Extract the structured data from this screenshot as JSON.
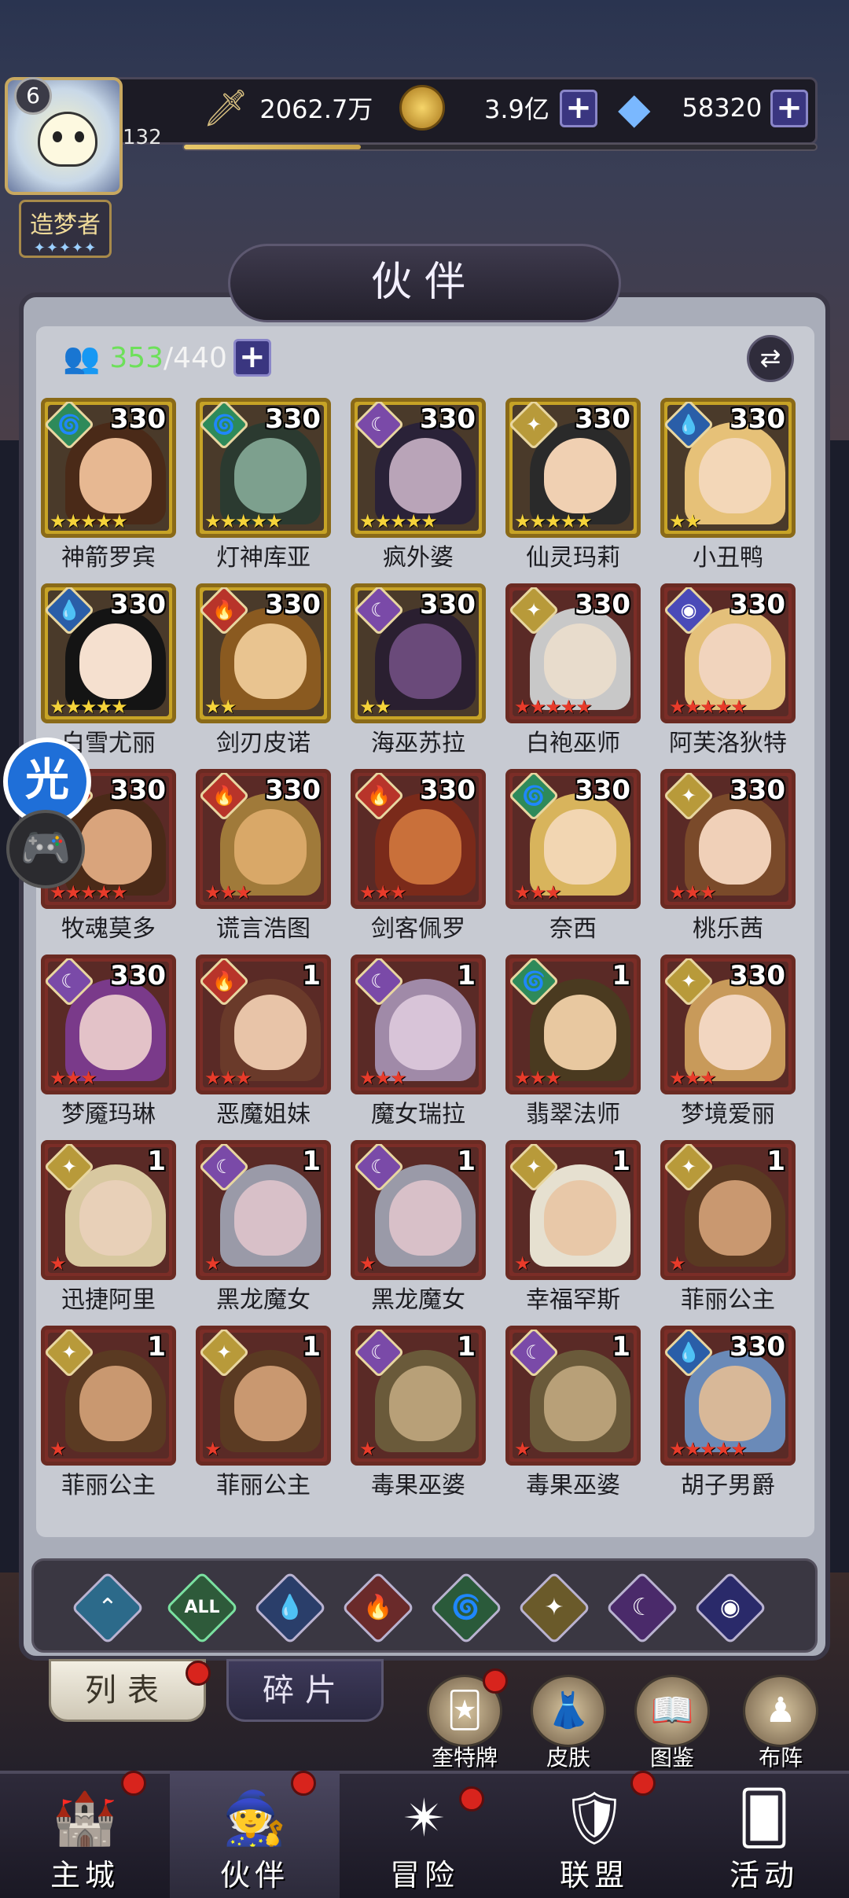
{
  "header": {
    "level_badge": "6",
    "player_level": "132",
    "title": "造梦者",
    "title_stars": "✦✦✦✦✦",
    "power": "2062.7万",
    "gold": "3.9亿",
    "gems": "58320",
    "exp_progress": 0.28
  },
  "panel": {
    "title": "伙伴",
    "owned": "353",
    "capacity": "/440"
  },
  "cards": [
    {
      "name": "神箭罗宾",
      "num": "330",
      "stars": "★★★★★",
      "starColor": "y",
      "elem": "wind",
      "frame": "gold",
      "skin": "#e7b892",
      "hair": "#4a2a18"
    },
    {
      "name": "灯神库亚",
      "num": "330",
      "stars": "★★★★★",
      "starColor": "y",
      "elem": "wind",
      "frame": "gold",
      "skin": "#7da08e",
      "hair": "#2b3a30"
    },
    {
      "name": "疯外婆",
      "num": "330",
      "stars": "★★★★★",
      "starColor": "y",
      "elem": "moon",
      "frame": "gold",
      "skin": "#b9a4b8",
      "hair": "#2a2238"
    },
    {
      "name": "仙灵玛莉",
      "num": "330",
      "stars": "★★★★★",
      "starColor": "y",
      "elem": "light",
      "frame": "gold",
      "skin": "#f0d0b2",
      "hair": "#2a2a2a"
    },
    {
      "name": "小丑鸭",
      "num": "330",
      "stars": "★★",
      "starColor": "y",
      "elem": "water",
      "frame": "gold",
      "skin": "#f3d7b8",
      "hair": "#e6c178"
    },
    {
      "name": "白雪尤丽",
      "num": "330",
      "stars": "★★★★★",
      "starColor": "y",
      "elem": "water",
      "frame": "gold",
      "skin": "#f5e0cf",
      "hair": "#141414"
    },
    {
      "name": "剑刃皮诺",
      "num": "330",
      "stars": "★★",
      "starColor": "y",
      "elem": "fire",
      "frame": "gold",
      "skin": "#e9c490",
      "hair": "#8a5a20"
    },
    {
      "name": "海巫苏拉",
      "num": "330",
      "stars": "★★",
      "starColor": "y",
      "elem": "moon",
      "frame": "gold",
      "skin": "#6a4a7a",
      "hair": "#2a1f30"
    },
    {
      "name": "白袍巫师",
      "num": "330",
      "stars": "★★★★★",
      "starColor": "r",
      "elem": "light",
      "frame": "red",
      "skin": "#e8dccc",
      "hair": "#c8c8c8"
    },
    {
      "name": "阿芙洛狄特",
      "num": "330",
      "stars": "★★★★★",
      "starColor": "r",
      "elem": "cosmos",
      "frame": "red",
      "skin": "#f1d4bd",
      "hair": "#e4c07a"
    },
    {
      "name": "牧魂莫多",
      "num": "330",
      "stars": "★★★★★",
      "starColor": "r",
      "elem": "fire",
      "frame": "red",
      "skin": "#d9a47c",
      "hair": "#4a2a18"
    },
    {
      "name": "谎言浩图",
      "num": "330",
      "stars": "★★★",
      "starColor": "r",
      "elem": "fire",
      "frame": "red",
      "skin": "#d9a868",
      "hair": "#a07a3a"
    },
    {
      "name": "剑客佩罗",
      "num": "330",
      "stars": "★★★",
      "starColor": "r",
      "elem": "fire",
      "frame": "red",
      "skin": "#c9703a",
      "hair": "#7a2a1a"
    },
    {
      "name": "奈西",
      "num": "330",
      "stars": "★★★",
      "starColor": "r",
      "elem": "wind",
      "frame": "red",
      "skin": "#f2d6b2",
      "hair": "#d8b45c"
    },
    {
      "name": "桃乐茜",
      "num": "330",
      "stars": "★★★",
      "starColor": "r",
      "elem": "light",
      "frame": "red",
      "skin": "#f0d0b8",
      "hair": "#7a4a2a"
    },
    {
      "name": "梦魇玛琳",
      "num": "330",
      "stars": "★★★",
      "starColor": "r",
      "elem": "moon",
      "frame": "red",
      "skin": "#e3c2c8",
      "hair": "#7a3a8a"
    },
    {
      "name": "恶魔姐妹",
      "num": "1",
      "stars": "★★★",
      "starColor": "r",
      "elem": "fire",
      "frame": "red",
      "skin": "#e8c4a8",
      "hair": "#6a3a2a"
    },
    {
      "name": "魔女瑞拉",
      "num": "1",
      "stars": "★★★",
      "starColor": "r",
      "elem": "moon",
      "frame": "red",
      "skin": "#d8c4d8",
      "hair": "#a08aa8"
    },
    {
      "name": "翡翠法师",
      "num": "1",
      "stars": "★★★",
      "starColor": "r",
      "elem": "wind",
      "frame": "red",
      "skin": "#e8c8a0",
      "hair": "#4a3a20"
    },
    {
      "name": "梦境爱丽",
      "num": "330",
      "stars": "★★★",
      "starColor": "r",
      "elem": "light",
      "frame": "red",
      "skin": "#f2d6c0",
      "hair": "#c89a5a"
    },
    {
      "name": "迅捷阿里",
      "num": "1",
      "stars": "★",
      "starColor": "r",
      "elem": "light",
      "frame": "red",
      "skin": "#e8d0b8",
      "hair": "#d8c8a0"
    },
    {
      "name": "黑龙魔女",
      "num": "1",
      "stars": "★",
      "starColor": "r",
      "elem": "moon",
      "frame": "red",
      "skin": "#d8c0c8",
      "hair": "#9a9aa8"
    },
    {
      "name": "黑龙魔女",
      "num": "1",
      "stars": "★",
      "starColor": "r",
      "elem": "moon",
      "frame": "red",
      "skin": "#d8c0c8",
      "hair": "#9a9aa8"
    },
    {
      "name": "幸福罕斯",
      "num": "1",
      "stars": "★",
      "starColor": "r",
      "elem": "light",
      "frame": "red",
      "skin": "#e8c8a8",
      "hair": "#e6e0d0"
    },
    {
      "name": "菲丽公主",
      "num": "1",
      "stars": "★",
      "starColor": "r",
      "elem": "light",
      "frame": "red",
      "skin": "#c99870",
      "hair": "#5a3a22"
    },
    {
      "name": "菲丽公主",
      "num": "1",
      "stars": "★",
      "starColor": "r",
      "elem": "light",
      "frame": "red",
      "skin": "#c99870",
      "hair": "#5a3a22"
    },
    {
      "name": "菲丽公主",
      "num": "1",
      "stars": "★",
      "starColor": "r",
      "elem": "light",
      "frame": "red",
      "skin": "#c99870",
      "hair": "#5a3a22"
    },
    {
      "name": "毒果巫婆",
      "num": "1",
      "stars": "★",
      "starColor": "r",
      "elem": "moon",
      "frame": "red",
      "skin": "#b8a078",
      "hair": "#6a5a3a"
    },
    {
      "name": "毒果巫婆",
      "num": "1",
      "stars": "★",
      "starColor": "r",
      "elem": "moon",
      "frame": "red",
      "skin": "#b8a078",
      "hair": "#6a5a3a"
    },
    {
      "name": "胡子男爵",
      "num": "330",
      "stars": "★★★★★",
      "starColor": "r",
      "elem": "water",
      "frame": "red",
      "skin": "#d8b898",
      "hair": "#6a8ab8"
    }
  ],
  "elements": {
    "water": {
      "glyph": "💧",
      "color": "#2a5ea8"
    },
    "fire": {
      "glyph": "🔥",
      "color": "#b8342a"
    },
    "wind": {
      "glyph": "🌀",
      "color": "#2e8a5a"
    },
    "light": {
      "glyph": "✦",
      "color": "#b89a3a"
    },
    "moon": {
      "glyph": "☾",
      "color": "#7a4aa8"
    },
    "cosmos": {
      "glyph": "◉",
      "color": "#4a4ab8"
    }
  },
  "filters": [
    {
      "id": "filter-guard",
      "glyph": "⌃",
      "color": "#2c6a8a"
    },
    {
      "id": "filter-all",
      "glyph": "ALL",
      "color": "#2e5a3a"
    },
    {
      "id": "filter-water",
      "glyph": "💧",
      "color": "#2a3e6a"
    },
    {
      "id": "filter-fire",
      "glyph": "🔥",
      "color": "#6a2a2a"
    },
    {
      "id": "filter-wind",
      "glyph": "🌀",
      "color": "#2a5a3a"
    },
    {
      "id": "filter-light",
      "glyph": "✦",
      "color": "#6a5a2a"
    },
    {
      "id": "filter-moon",
      "glyph": "☾",
      "color": "#4a2a6a"
    },
    {
      "id": "filter-cosmos",
      "glyph": "◉",
      "color": "#2a2a6a"
    }
  ],
  "tabs": {
    "list": "列表",
    "fragments": "碎片"
  },
  "side_buttons": {
    "tarot": "奎特牌",
    "skins": "皮肤",
    "codex": "图鉴",
    "formation": "布阵"
  },
  "nav": {
    "city": "主城",
    "partners": "伙伴",
    "adventure": "冒险",
    "alliance": "联盟",
    "events": "活动"
  },
  "floating": {
    "accelerator": "光"
  }
}
